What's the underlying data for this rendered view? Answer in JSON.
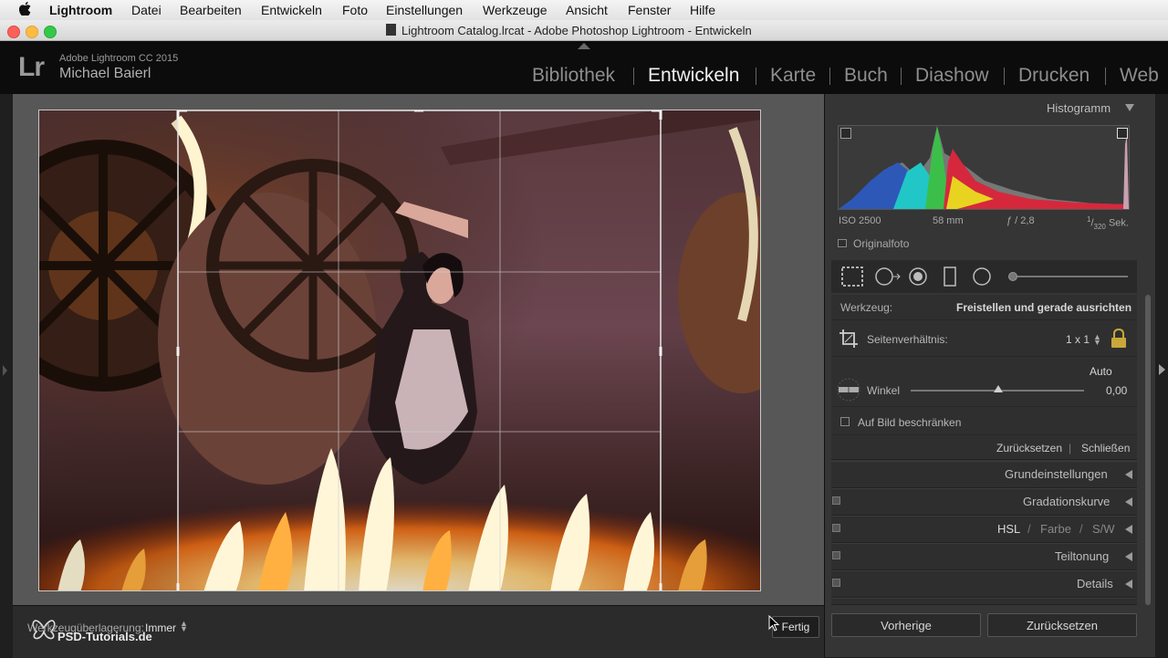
{
  "menubar": {
    "icon": "apple-icon",
    "items": [
      "Lightroom",
      "Datei",
      "Bearbeiten",
      "Entwickeln",
      "Foto",
      "Einstellungen",
      "Werkzeuge",
      "Ansicht",
      "Fenster",
      "Hilfe"
    ]
  },
  "window": {
    "title": "Lightroom Catalog.lrcat - Adobe Photoshop Lightroom - Entwickeln"
  },
  "identity": {
    "logo": "Lr",
    "product": "Adobe Lightroom CC 2015",
    "user": "Michael Baierl"
  },
  "modules": [
    "Bibliothek",
    "Entwickeln",
    "Karte",
    "Buch",
    "Diashow",
    "Drucken",
    "Web"
  ],
  "active_module": "Entwickeln",
  "histogram": {
    "title": "Histogramm",
    "iso": "ISO 2500",
    "focal": "58 mm",
    "aperture": "ƒ / 2,8",
    "shutter_num": "1",
    "shutter_den": "320",
    "shutter_unit": "Sek.",
    "original_photo": "Originalfoto"
  },
  "crop_panel": {
    "tool_label": "Werkzeug:",
    "tool_value": "Freistellen und gerade ausrichten",
    "aspect_label": "Seitenverhältnis:",
    "aspect_value": "1 x 1",
    "auto": "Auto",
    "angle_label": "Winkel",
    "angle_value": "0,00",
    "constrain_label": "Auf Bild beschränken",
    "reset": "Zurücksetzen",
    "close": "Schließen"
  },
  "sections": [
    {
      "title": "Grundeinstellungen"
    },
    {
      "title": "Gradationskurve"
    },
    {
      "title_parts": [
        "HSL",
        "/",
        "Farbe",
        "/",
        "S/W"
      ]
    },
    {
      "title": "Teiltonung"
    },
    {
      "title": "Details"
    }
  ],
  "toolbar": {
    "overlay_label": "Werkzeugüberlagerung:",
    "overlay_value": "Immer",
    "done": "Fertig",
    "watermark": "PSD-Tutorials.de"
  },
  "bottom_buttons": {
    "previous": "Vorherige",
    "reset": "Zurücksetzen"
  }
}
